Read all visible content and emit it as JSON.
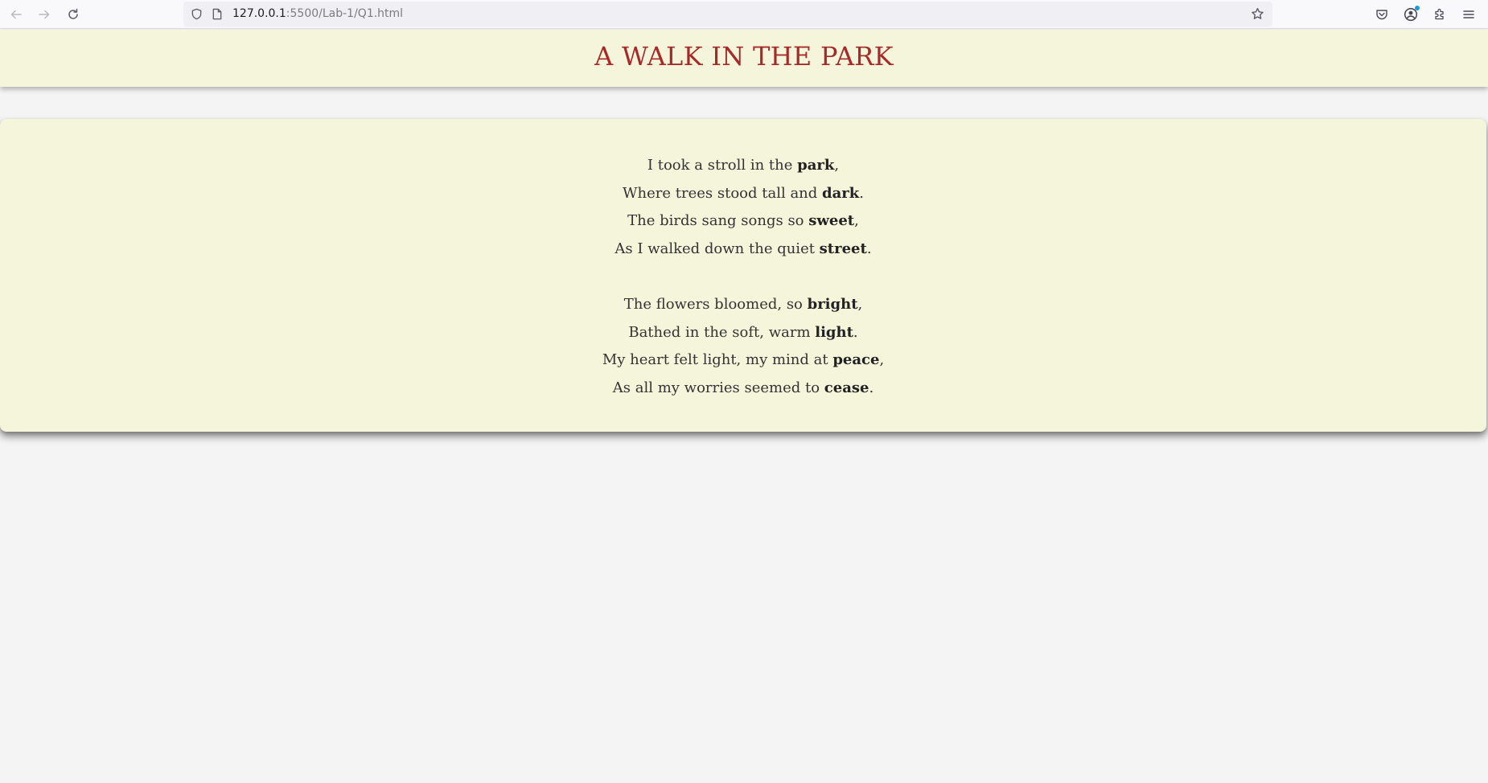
{
  "browser": {
    "url_host": "127.0.0.1",
    "url_path": ":5500/Lab-1/Q1.html",
    "icons": {
      "back": "arrow-left-icon",
      "forward": "arrow-right-icon",
      "reload": "reload-icon",
      "tracking": "shield-icon",
      "page": "page-icon",
      "bookmark": "star-icon",
      "pocket": "pocket-icon",
      "account": "account-icon",
      "extensions": "puzzle-icon",
      "menu": "hamburger-menu-icon"
    }
  },
  "page": {
    "title": "A WALK IN THE PARK",
    "title_color": "#a52a2a",
    "background": "#f5f5dc",
    "stanzas": [
      [
        {
          "before": "I took a stroll in the ",
          "bold": "park",
          "after": ","
        },
        {
          "before": "Where trees stood tall and ",
          "bold": "dark",
          "after": "."
        },
        {
          "before": "The birds sang songs so ",
          "bold": "sweet",
          "after": ","
        },
        {
          "before": "As I walked down the quiet ",
          "bold": "street",
          "after": "."
        }
      ],
      [
        {
          "before": "The flowers bloomed, so ",
          "bold": "bright",
          "after": ","
        },
        {
          "before": "Bathed in the soft, warm ",
          "bold": "light",
          "after": "."
        },
        {
          "before": "My heart felt light, my mind at ",
          "bold": "peace",
          "after": ","
        },
        {
          "before": "As all my worries seemed to ",
          "bold": "cease",
          "after": "."
        }
      ]
    ]
  }
}
